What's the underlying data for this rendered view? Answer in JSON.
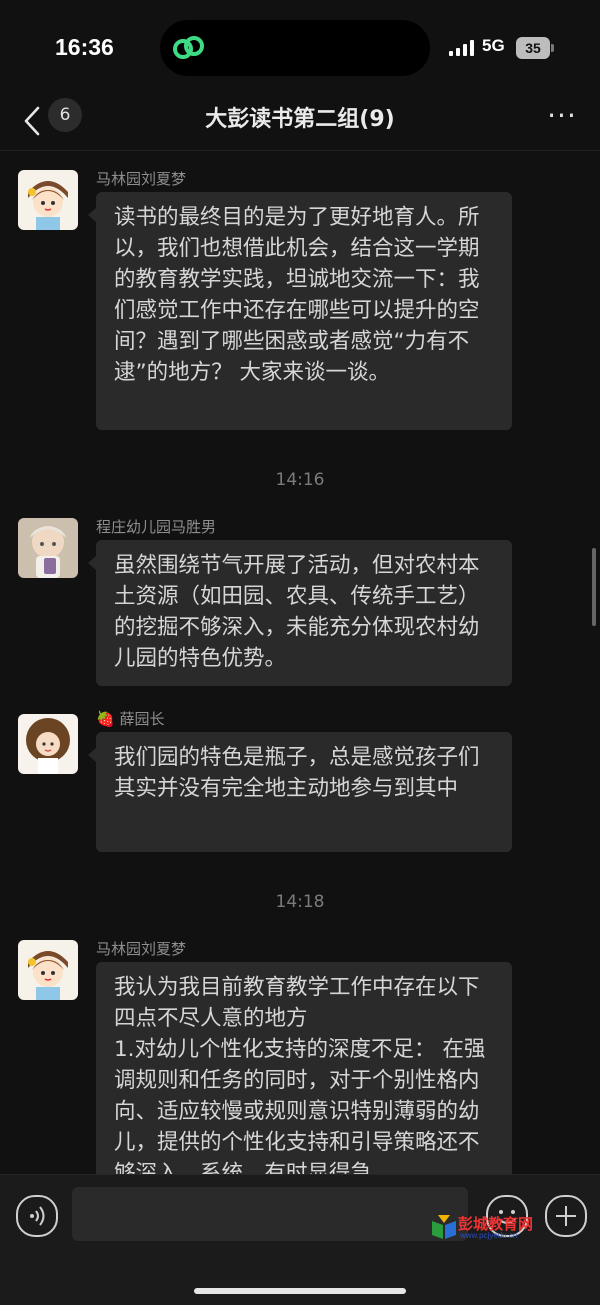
{
  "status_bar": {
    "time": "16:36",
    "network": "5G",
    "battery": "35"
  },
  "nav": {
    "unread_count": "6",
    "title": "大彭读书第二组(9)",
    "more": "···"
  },
  "messages": [
    {
      "sender": "马林园刘夏梦",
      "text": "读书的最终目的是为了更好地育人。所以，我们也想借此机会，结合这一学期的教育教学实践，坦诚地交流一下：我们感觉工作中还存在哪些可以提升的空间？遇到了哪些困惑或者感觉“力有不逮”的地方？ 大家来谈一谈。"
    },
    {
      "timestamp": "14:16"
    },
    {
      "sender": "程庄幼儿园马胜男",
      "text": "虽然围绕节气开展了活动，但对农村本土资源（如田园、农具、传统手工艺）的挖掘不够深入，未能充分体现农村幼儿园的特色优势。"
    },
    {
      "sender": "🍓 薛园长",
      "text": "我们园的特色是瓶子，总是感觉孩子们其实并没有完全地主动地参与到其中"
    },
    {
      "timestamp": "14:18"
    },
    {
      "sender": "马林园刘夏梦",
      "text": "我认为我目前教育教学工作中存在以下四点不尽人意的地方\n1.对幼儿个性化支持的深度不足： 在强调规则和任务的同时，对于个别性格内向、适应较慢或规则意识特别薄弱的幼儿，提供的个性化支持和引导策略还不够深入、系统，有时显得急"
    }
  ],
  "input": {
    "placeholder": ""
  },
  "watermark": {
    "name": "彭城教育网",
    "url": "www.pcjyedu.cn"
  },
  "colors": {
    "background": "#111111",
    "bubble": "#2a2a2a",
    "text": "#d6d6d6",
    "sender": "#8e8e8e",
    "accent_green": "#3ddc84"
  }
}
